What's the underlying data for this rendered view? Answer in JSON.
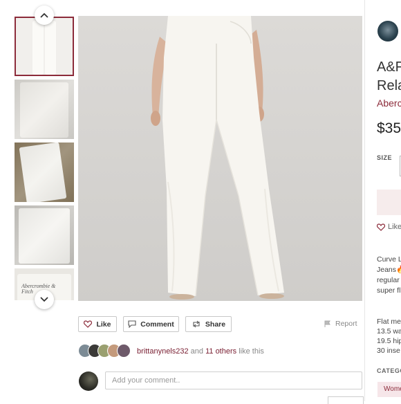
{
  "gallery": {
    "prev_icon": "chevron-up-icon",
    "next_icon": "chevron-down-icon",
    "thumbnails": [
      "thumb-1",
      "thumb-2",
      "thumb-3",
      "thumb-4",
      "thumb-5"
    ],
    "active_index": 0,
    "thumb_5_label_text": "Abercrombie & Fitch"
  },
  "actions": {
    "like_label": "Like",
    "comment_label": "Comment",
    "share_label": "Share",
    "report_label": "Report"
  },
  "likes": {
    "user": "brittanynels232",
    "and_text": "and",
    "others": "11 others",
    "suffix": "like this"
  },
  "comment": {
    "placeholder": "Add your comment.."
  },
  "listing": {
    "title_line1": "A&F",
    "title_line2": "Rela",
    "brand": "Aberc",
    "price": "$35",
    "size_label": "SIZE",
    "like_label": "Like",
    "description_lines": [
      "Curve L",
      "Jeans",
      "regular",
      "super fl"
    ],
    "measurements": [
      "Flat me",
      "13.5 wa",
      "19.5 hip",
      "30 inse"
    ],
    "category_label": "CATEGO",
    "category_chip": "Wome"
  },
  "colors": {
    "accent": "#8c2b3a",
    "photo_bg": "#d6d4d1",
    "jeans": "#f7f5f0"
  }
}
